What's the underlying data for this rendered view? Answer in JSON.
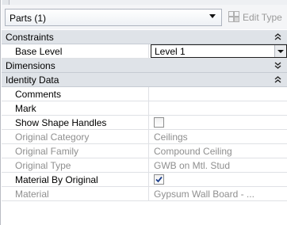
{
  "type_selector": {
    "value": "Parts (1)"
  },
  "edit_type": {
    "label": "Edit Type",
    "enabled": false
  },
  "groups": {
    "constraints": {
      "label": "Constraints"
    },
    "dimensions": {
      "label": "Dimensions"
    },
    "identity": {
      "label": "Identity Data"
    }
  },
  "properties": {
    "base_level": {
      "name": "Base Level",
      "value": "Level 1"
    },
    "comments": {
      "name": "Comments",
      "value": ""
    },
    "mark": {
      "name": "Mark",
      "value": ""
    },
    "show_shape_handles": {
      "name": "Show Shape Handles",
      "checked": false
    },
    "original_category": {
      "name": "Original Category",
      "value": "Ceilings"
    },
    "original_family": {
      "name": "Original Family",
      "value": "Compound Ceiling"
    },
    "original_type": {
      "name": "Original Type",
      "value": "GWB on Mtl. Stud"
    },
    "material_by_original": {
      "name": "Material By Original",
      "checked": true
    },
    "material": {
      "name": "Material",
      "value": "Gypsum Wall Board - ..."
    }
  },
  "colors": {
    "group_header_bg": "#dfe3e8",
    "readonly_text": "#8f8f8f",
    "grid_line": "#dfe1e5"
  }
}
